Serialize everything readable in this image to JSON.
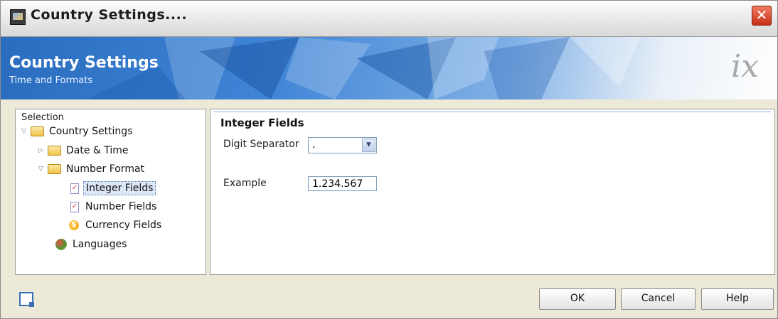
{
  "window": {
    "title": "Country Settings...."
  },
  "banner": {
    "title": "Country Settings",
    "subtitle": "Time and Formats",
    "logo": "ix"
  },
  "selection": {
    "header": "Selection",
    "items": [
      {
        "label": "Country Settings",
        "icon": "folder-icon",
        "expanded": true
      },
      {
        "label": "Date & Time",
        "icon": "folder-icon",
        "expanded": false
      },
      {
        "label": "Number Format",
        "icon": "folder-icon",
        "expanded": true
      },
      {
        "label": "Integer Fields",
        "icon": "field-icon",
        "selected": true
      },
      {
        "label": "Number Fields",
        "icon": "field-icon"
      },
      {
        "label": "Currency Fields",
        "icon": "coin-icon"
      },
      {
        "label": "Languages",
        "icon": "globe-icon"
      }
    ]
  },
  "content": {
    "section_title": "Integer Fields",
    "digit_separator": {
      "label": "Digit Separator",
      "value": "."
    },
    "example": {
      "label": "Example",
      "value": "1.234.567"
    }
  },
  "buttons": {
    "ok": "OK",
    "cancel": "Cancel",
    "help": "Help"
  },
  "colors": {
    "banner_blue": "#2a6dbf",
    "close_red": "#c9301a",
    "selection_highlight": "#dbe6f6"
  }
}
